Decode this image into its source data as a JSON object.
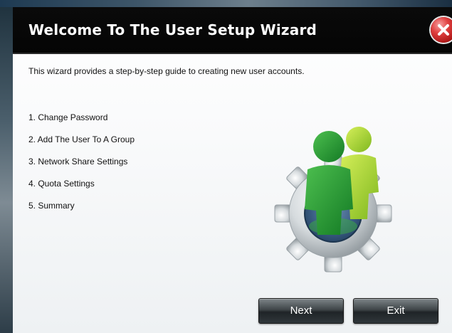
{
  "dialog": {
    "title": "Welcome To The User Setup Wizard",
    "intro": "This wizard provides a step-by-step guide to creating new user accounts.",
    "steps": [
      "1. Change Password",
      "2. Add The User To A Group",
      "3. Network Share Settings",
      "4. Quota Settings",
      "5. Summary"
    ],
    "buttons": {
      "next": "Next",
      "exit": "Exit"
    },
    "illustration_icon": "users-gear-icon",
    "close_icon": "close-icon"
  },
  "colors": {
    "titlebar": "#050505",
    "close_button": "#d32f2f",
    "user_dark_green": "#1f8a2e",
    "user_light_green": "#9ccc2a",
    "gear": "#c8cfd4",
    "button": "#3f4548"
  }
}
